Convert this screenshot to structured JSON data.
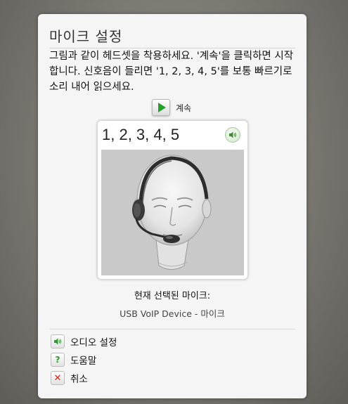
{
  "dialog": {
    "title": "마이크 설정",
    "instructions": "그림과 같이 헤드셋을 착용하세요. '계속'을 클릭하면 시작합니다. 신호음이 들리면 '1, 2, 3, 4, 5'를 보통 빠르기로 소리 내어 읽으세요.",
    "continue_label": "계속",
    "card_text": "1, 2, 3, 4, 5",
    "current_mic_label": "현재 선택된 마이크:",
    "device_name": "USB VoIP Device - 마이크",
    "links": {
      "audio_settings": "오디오 설정",
      "help": "도움말",
      "cancel": "취소"
    }
  },
  "icons": {
    "play": "play-icon",
    "speaker": "speaker-icon",
    "help": "question-icon",
    "cancel": "close-icon"
  },
  "colors": {
    "play_green": "#27a02b",
    "cancel_red": "#d0211b",
    "help_green": "#2f9a2f"
  }
}
